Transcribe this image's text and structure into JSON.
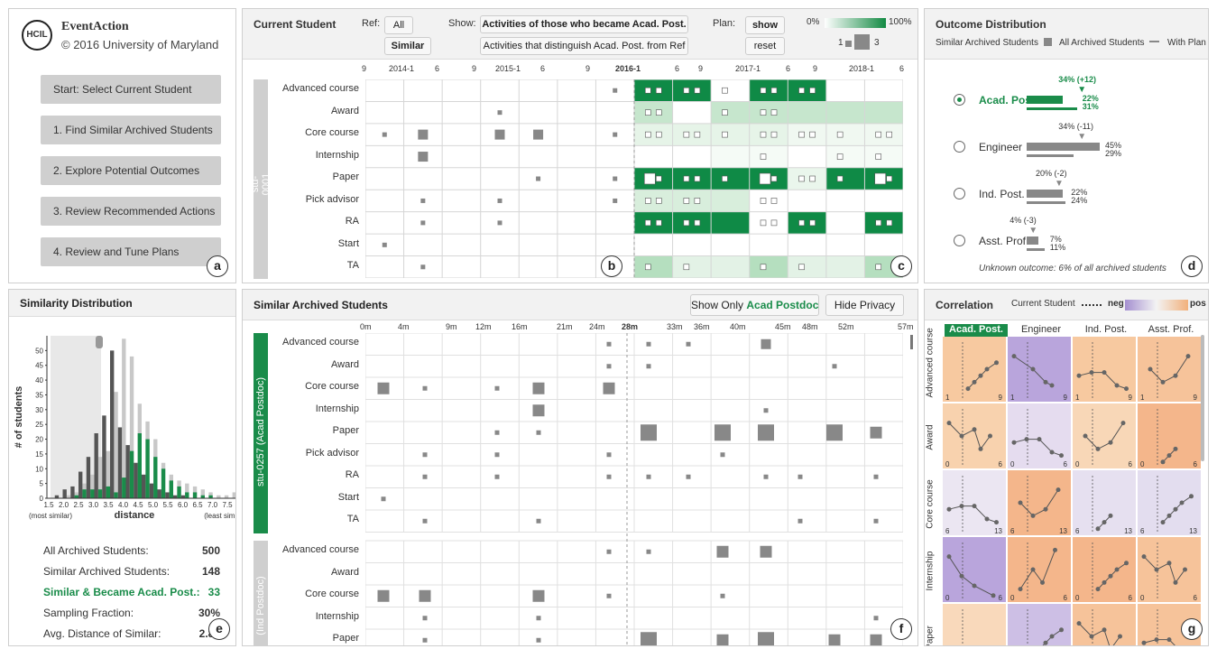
{
  "app": {
    "name": "EventAction",
    "copyright": "© 2016 University of Maryland",
    "logo": "HCIL"
  },
  "nav": [
    "Start: Select Current Student",
    "1. Find Similar Archived Students",
    "2. Explore Potential Outcomes",
    "3. Review Recommended Actions",
    "4. Review and Tune Plans"
  ],
  "badges": [
    "a",
    "b",
    "c",
    "d",
    "e",
    "f",
    "g"
  ],
  "current": {
    "title": "Current Student",
    "ref_label": "Ref:",
    "ref_all": "All",
    "ref_similar": "Similar",
    "show_label": "Show:",
    "show_opt1": "Activities of those who became Acad. Post.",
    "show_opt2": "Activities that distinguish Acad. Post. from Ref",
    "plan_label": "Plan:",
    "plan_show": "show",
    "plan_reset": "reset",
    "pct_lo": "0%",
    "pct_hi": "100%",
    "size_lo": "1",
    "size_hi": "3",
    "student": "stu-0001",
    "ticks": [
      "9",
      "2014-1",
      "6",
      "9",
      "2015-1",
      "6",
      "9",
      "2016-1",
      "6",
      "9",
      "2017-1",
      "6",
      "9",
      "2018-1",
      "6"
    ]
  },
  "rows": [
    "Advanced course",
    "Award",
    "Core course",
    "Internship",
    "Paper",
    "Pick advisor",
    "RA",
    "Start",
    "TA"
  ],
  "outcome": {
    "title": "Outcome Distribution",
    "legend": "Similar Archived Students",
    "legend2": "All Archived Students",
    "legend3": "With Plan",
    "footer": "Unknown outcome: 6% of all archived students",
    "items": [
      {
        "name": "Acad. Post.",
        "plan": "34% (+12)",
        "sim": "22%",
        "all": "31%",
        "selected": true,
        "simv": 22,
        "allv": 31,
        "planv": 34
      },
      {
        "name": "Engineer",
        "plan": "34% (-11)",
        "sim": "45%",
        "all": "29%",
        "selected": false,
        "simv": 45,
        "allv": 29,
        "planv": 34
      },
      {
        "name": "Ind. Post.",
        "plan": "20% (-2)",
        "sim": "22%",
        "all": "24%",
        "selected": false,
        "simv": 22,
        "allv": 24,
        "planv": 20
      },
      {
        "name": "Asst. Prof.",
        "plan": "4% (-3)",
        "sim": "7%",
        "all": "11%",
        "selected": false,
        "simv": 7,
        "allv": 11,
        "planv": 4
      }
    ]
  },
  "simdist": {
    "title": "Similarity Distribution",
    "ylabel": "# of students",
    "xlabel": "distance",
    "most": "(most similar)",
    "least": "(least similar)",
    "yticks": [
      "0",
      "5",
      "10",
      "15",
      "20",
      "25",
      "30",
      "35",
      "40",
      "45",
      "50"
    ],
    "xticks": [
      "1.5",
      "2.0",
      "2.5",
      "3.0",
      "3.5",
      "4.0",
      "4.5",
      "5.0",
      "5.5",
      "6.0",
      "6.5",
      "7.0",
      "7.5"
    ]
  },
  "stats": [
    {
      "label": "All Archived Students:",
      "value": "500"
    },
    {
      "label": "Similar Archived Students:",
      "value": "148"
    },
    {
      "label": "Similar & Became Acad. Post.:",
      "value": "33"
    },
    {
      "label": "Sampling Fraction:",
      "value": "30%"
    },
    {
      "label": "Avg. Distance of Similar:",
      "value": "2.87"
    }
  ],
  "archived": {
    "title": "Similar Archived Students",
    "btn1_pre": "Show Only ",
    "btn1_b": "Acad Postdoc",
    "btn2": "Hide Privacy",
    "ticks": [
      "0m",
      "4m",
      "9m",
      "12m",
      "16m",
      "21m",
      "24m",
      "28m",
      "33m",
      "36m",
      "40m",
      "45m",
      "48m",
      "52m",
      "57m"
    ],
    "stu1": "stu-0257 (Acad Postdoc)",
    "stu2": "(Ind Postdoc)"
  },
  "correlation": {
    "title": "Correlation",
    "cur": "Current Student",
    "neg": "neg",
    "pos": "pos",
    "cols": [
      "Acad. Post.",
      "Engineer",
      "Ind. Post.",
      "Asst. Prof."
    ],
    "rows": [
      "Advanced course",
      "Award",
      "Core course",
      "Internship",
      "Paper"
    ],
    "axes": [
      [
        "1",
        "9"
      ],
      [
        "0",
        "6"
      ],
      [
        "6",
        "13"
      ],
      [
        "0",
        "6"
      ],
      [
        "",
        ""
      ]
    ]
  },
  "colors": {
    "green": "#1a8c4a",
    "gray": "#888888"
  }
}
